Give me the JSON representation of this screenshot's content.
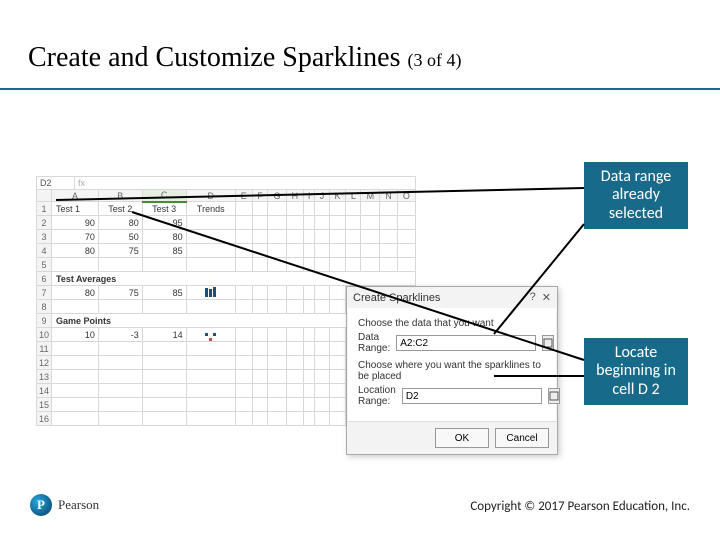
{
  "title": "Create and Customize Sparklines",
  "title_suffix": "(3 of 4)",
  "callouts": {
    "data_range": "Data range already selected",
    "locate": "Locate beginning in cell D 2"
  },
  "sheet": {
    "columns": [
      "",
      "A",
      "B",
      "C",
      "D",
      "E",
      "F",
      "G",
      "H",
      "I",
      "J",
      "K",
      "L",
      "M",
      "N",
      "O"
    ],
    "namebox": "D2",
    "rows": [
      {
        "n": "1",
        "cells": [
          "",
          "Test 1",
          "Test 2",
          "Test 3",
          "Trends",
          "",
          "",
          "",
          "",
          "",
          "",
          "",
          "",
          "",
          "",
          ""
        ]
      },
      {
        "n": "2",
        "cells": [
          "",
          "90",
          "80",
          "95",
          "",
          "",
          "",
          "",
          "",
          "",
          "",
          "",
          "",
          "",
          "",
          ""
        ]
      },
      {
        "n": "3",
        "cells": [
          "",
          "70",
          "50",
          "80",
          "",
          "",
          "",
          "",
          "",
          "",
          "",
          "",
          "",
          "",
          "",
          ""
        ]
      },
      {
        "n": "4",
        "cells": [
          "",
          "80",
          "75",
          "85",
          "",
          "",
          "",
          "",
          "",
          "",
          "",
          "",
          "",
          "",
          "",
          ""
        ]
      },
      {
        "n": "5",
        "cells": [
          "",
          "",
          "",
          "",
          "",
          "",
          "",
          "",
          "",
          "",
          "",
          "",
          "",
          "",
          "",
          ""
        ]
      },
      {
        "n": "6",
        "section": "Test Averages"
      },
      {
        "n": "7",
        "cells": [
          "",
          "80",
          "75",
          "85",
          "BARS",
          "",
          "",
          "",
          "",
          "",
          "",
          "",
          "",
          "",
          "",
          ""
        ]
      },
      {
        "n": "8",
        "cells": [
          "",
          "",
          "",
          "",
          "",
          "",
          "",
          "",
          "",
          "",
          "",
          "",
          "",
          "",
          "",
          ""
        ]
      },
      {
        "n": "9",
        "section": "Game Points"
      },
      {
        "n": "10",
        "cells": [
          "",
          "10",
          "-3",
          "14",
          "WL",
          "",
          "",
          "",
          "",
          "",
          "",
          "",
          "",
          "",
          "",
          ""
        ]
      },
      {
        "n": "11",
        "cells": [
          "",
          "",
          "",
          "",
          "",
          "",
          "",
          "",
          "",
          "",
          "",
          "",
          "",
          "",
          "",
          ""
        ]
      },
      {
        "n": "12",
        "cells": [
          "",
          "",
          "",
          "",
          "",
          "",
          "",
          "",
          "",
          "",
          "",
          "",
          "",
          "",
          "",
          ""
        ]
      },
      {
        "n": "13",
        "cells": [
          "",
          "",
          "",
          "",
          "",
          "",
          "",
          "",
          "",
          "",
          "",
          "",
          "",
          "",
          "",
          ""
        ]
      },
      {
        "n": "14",
        "cells": [
          "",
          "",
          "",
          "",
          "",
          "",
          "",
          "",
          "",
          "",
          "",
          "",
          "",
          "",
          "",
          ""
        ]
      },
      {
        "n": "15",
        "cells": [
          "",
          "",
          "",
          "",
          "",
          "",
          "",
          "",
          "",
          "",
          "",
          "",
          "",
          "",
          "",
          ""
        ]
      },
      {
        "n": "16",
        "cells": [
          "",
          "",
          "",
          "",
          "",
          "",
          "",
          "",
          "",
          "",
          "",
          "",
          "",
          "",
          "",
          ""
        ]
      }
    ]
  },
  "dialog": {
    "title": "Create Sparklines",
    "help": "?",
    "close": "✕",
    "choose_data_label": "Choose the data that you want",
    "data_range_label": "Data Range:",
    "data_range_value": "A2:C2",
    "choose_loc_label": "Choose where you want the sparklines to be placed",
    "location_range_label": "Location Range:",
    "location_range_value": "D2",
    "ok": "OK",
    "cancel": "Cancel"
  },
  "brand": "Pearson",
  "copyright": "Copyright © 2017 Pearson Education, Inc."
}
